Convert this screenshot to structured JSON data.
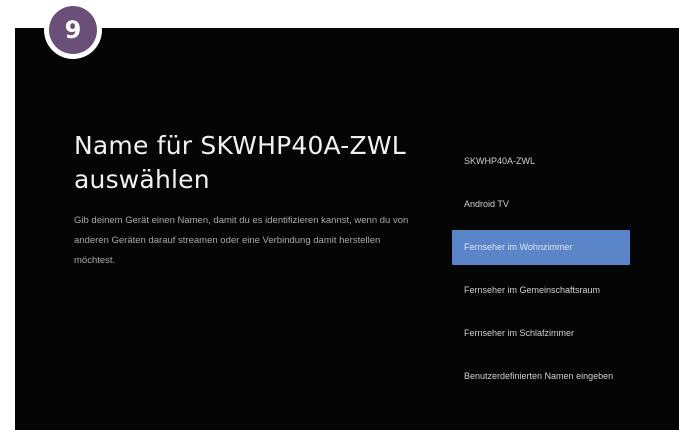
{
  "step": {
    "number": "9"
  },
  "dialog": {
    "title": "Name für SKWHP40A-ZWL auswählen",
    "description": "Gib deinem Gerät einen Namen, damit du es identifizieren kannst, wenn du von anderen Geräten darauf streamen oder eine Verbindung damit herstellen möchtest."
  },
  "options": [
    {
      "label": "SKWHP40A-ZWL",
      "selected": false
    },
    {
      "label": "Android TV",
      "selected": false
    },
    {
      "label": "Fernseher im Wohnzimmer",
      "selected": true
    },
    {
      "label": "Fernseher im Gemeinschaftsraum",
      "selected": false
    },
    {
      "label": "Fernseher im Schlafzimmer",
      "selected": false
    },
    {
      "label": "Benutzerdefinierten Namen eingeben",
      "selected": false
    }
  ],
  "colors": {
    "badge": "#6a4f78",
    "background": "#050505",
    "selected": "#5b85c9"
  }
}
